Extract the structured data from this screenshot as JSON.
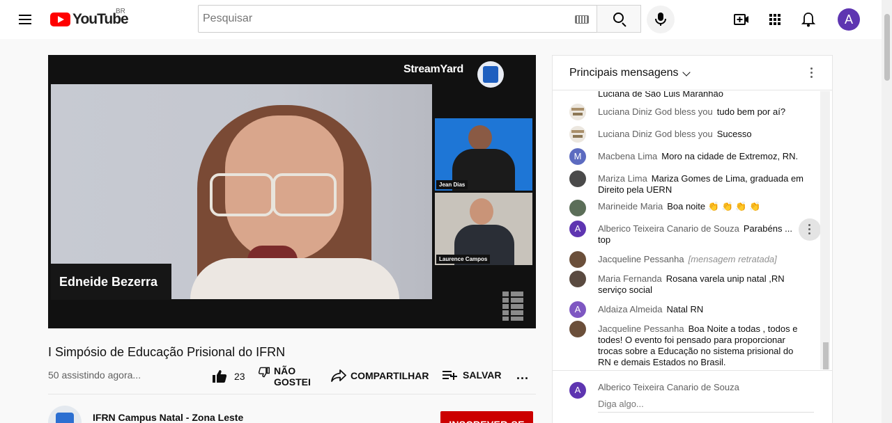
{
  "header": {
    "logo_text": "YouTube",
    "region": "BR",
    "search_placeholder": "Pesquisar",
    "avatar_letter": "A"
  },
  "player": {
    "brand": "StreamYard",
    "main_name": "Edneide Bezerra",
    "side_feeds": [
      "Jean Dias",
      "Laurence Campos"
    ]
  },
  "video": {
    "title": "I Simpósio de Educação Prisional do IFRN",
    "views": "50 assistindo agora...",
    "like_count": "23",
    "dislike_label_1": "NÃO",
    "dislike_label_2": "GOSTEI",
    "share_label": "COMPARTILHAR",
    "save_label": "SALVAR",
    "more_label": "..."
  },
  "channel": {
    "name": "IFRN Campus Natal - Zona Leste",
    "subscribe_label": "INSCREVER-SE"
  },
  "chat": {
    "header_title": "Principais mensagens",
    "messages": [
      {
        "author": "",
        "text": "Luciana de São Luis Maranhão",
        "avatar": ""
      },
      {
        "author": "Luciana Diniz God bless you",
        "text": "tudo bem por aí?",
        "avatar": ""
      },
      {
        "author": "Luciana Diniz God bless you",
        "text": "Sucesso",
        "avatar": ""
      },
      {
        "author": "Macbena Lima",
        "text": "Moro na cidade de Extremoz, RN.",
        "avatar": "M"
      },
      {
        "author": "Mariza Lima",
        "text": "Mariza Gomes de Lima, graduada em Direito pela UERN",
        "avatar": ""
      },
      {
        "author": "Marineide Maria",
        "text": "Boa noite 👏 👏 👏 👏",
        "avatar": ""
      },
      {
        "author": "Alberico Teixeira Canario de Souza",
        "text": "Parabéns ... top",
        "avatar": "A"
      },
      {
        "author": "Jacqueline Pessanha",
        "text": "[mensagem retratada]",
        "avatar": ""
      },
      {
        "author": "Maria Fernanda",
        "text": "Rosana varela unip natal ,RN serviço social",
        "avatar": ""
      },
      {
        "author": "Aldaiza Almeida",
        "text": "Natal RN",
        "avatar": "A"
      },
      {
        "author": "Jacqueline Pessanha",
        "text": "Boa Noite a todas , todos e todes! O evento foi pensado para proporcionar trocas sobre a Educação no sistema prisional do RN e demais Estados no Brasil.",
        "avatar": ""
      }
    ],
    "input_author": "Alberico Teixeira Canario de Souza",
    "input_avatar": "A",
    "input_placeholder": "Diga algo..."
  }
}
